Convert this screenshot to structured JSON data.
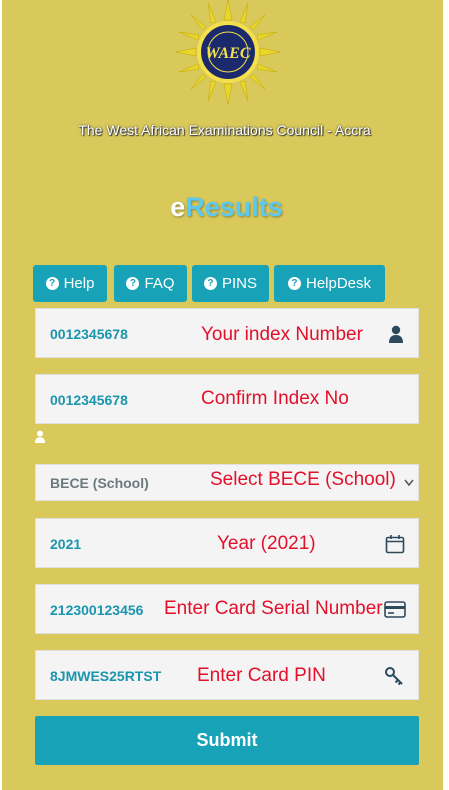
{
  "header": {
    "logo_text": "WAEC",
    "council_name": "The West African Examinations Council - Accra",
    "title_prefix": "e",
    "title_main": "Results"
  },
  "nav": {
    "buttons": [
      {
        "label": "Help",
        "icon": "question-circle-icon"
      },
      {
        "label": "FAQ",
        "icon": "question-circle-icon"
      },
      {
        "label": "PINS",
        "icon": "question-circle-icon"
      },
      {
        "label": "HelpDesk",
        "icon": "question-circle-icon"
      }
    ]
  },
  "form": {
    "index_number": {
      "value": "0012345678",
      "annotation": "Your index Number",
      "icon": "user-icon"
    },
    "confirm_index": {
      "value": "0012345678",
      "annotation": "Confirm Index No",
      "icon": "user-icon"
    },
    "exam_type": {
      "value": "BECE (School)",
      "annotation": "Select BECE (School)",
      "icon": "chevron-down-icon"
    },
    "year": {
      "value": "2021",
      "annotation": "Year (2021)",
      "icon": "calendar-icon"
    },
    "card_serial": {
      "value": "212300123456",
      "annotation": "Enter Card Serial Number",
      "icon": "credit-card-icon"
    },
    "card_pin": {
      "value": "8JMWES25RTST",
      "annotation": "Enter Card PIN",
      "icon": "key-icon"
    },
    "submit_label": "Submit"
  },
  "colors": {
    "background": "#d8c95a",
    "accent": "#17a2b8",
    "value_text": "#1b95ad",
    "annotation": "#e3102b",
    "title_highlight": "#5fc8ef"
  }
}
